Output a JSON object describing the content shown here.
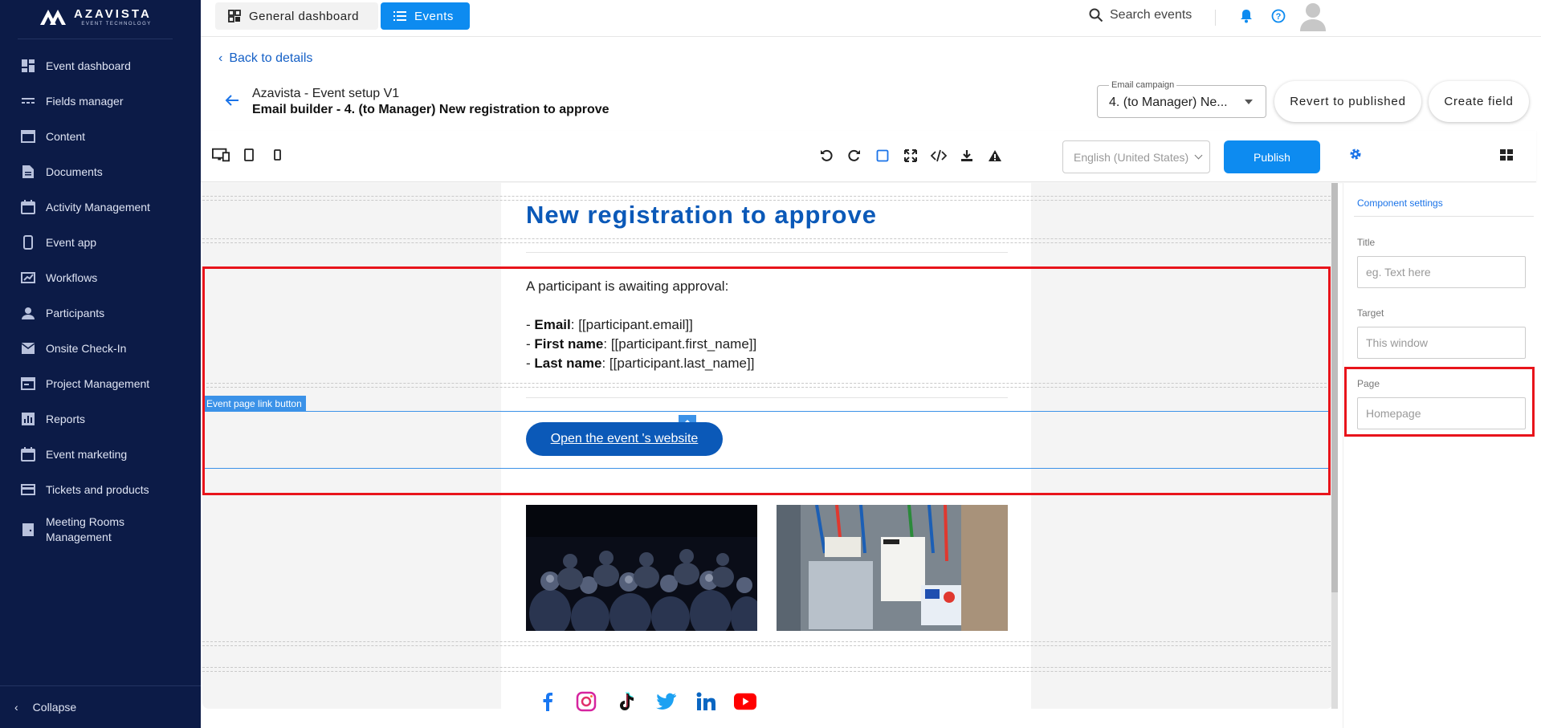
{
  "brand": {
    "name": "AZAVISTA",
    "tagline": "EVENT TECHNOLOGY"
  },
  "sidebar": {
    "items": [
      {
        "label": "Event dashboard",
        "icon": "dashboard-icon"
      },
      {
        "label": "Fields manager",
        "icon": "fields-icon"
      },
      {
        "label": "Content",
        "icon": "content-icon"
      },
      {
        "label": "Documents",
        "icon": "document-icon"
      },
      {
        "label": "Activity Management",
        "icon": "calendar-icon"
      },
      {
        "label": "Event app",
        "icon": "phone-icon"
      },
      {
        "label": "Workflows",
        "icon": "workflow-icon"
      },
      {
        "label": "Participants",
        "icon": "person-icon"
      },
      {
        "label": "Onsite Check-In",
        "icon": "mail-icon"
      },
      {
        "label": "Project Management",
        "icon": "project-icon"
      },
      {
        "label": "Reports",
        "icon": "chart-icon"
      },
      {
        "label": "Event marketing",
        "icon": "calendar-icon"
      },
      {
        "label": "Tickets and products",
        "icon": "card-icon"
      },
      {
        "label": "Meeting Rooms Management",
        "icon": "room-icon"
      }
    ],
    "collapse_label": "Collapse"
  },
  "topbar": {
    "tabs": [
      {
        "label": "General dashboard",
        "icon": "grid-icon"
      },
      {
        "label": "Events",
        "icon": "list-icon"
      }
    ],
    "search_label": "Search events"
  },
  "header": {
    "back_label": "Back to details",
    "title": "Azavista - Event setup V1",
    "subtitle": "Email builder - 4. (to Manager) New registration to approve",
    "campaign_label": "Email campaign",
    "campaign_value": "4. (to Manager) Ne...",
    "revert_label": "Revert to published",
    "create_label": "Create field"
  },
  "toolbar": {
    "language": "English (United States)",
    "publish_label": "Publish"
  },
  "email": {
    "heading": "New registration to approve",
    "intro": "A participant is awaiting approval:",
    "fields": [
      {
        "name": "Email",
        "value": ": [[participant.email]]"
      },
      {
        "name": "First name",
        "value": ": [[participant.first_name]]"
      },
      {
        "name": "Last name",
        "value": ": [[participant.last_name]]"
      }
    ],
    "block_tag": "Event page link button",
    "cta_label": "Open the event 's website"
  },
  "panel": {
    "title": "Component settings",
    "fields": [
      {
        "label": "Title",
        "placeholder": "eg. Text here"
      },
      {
        "label": "Target",
        "placeholder": "This window"
      },
      {
        "label": "Page",
        "placeholder": "Homepage"
      }
    ]
  },
  "colors": {
    "accent": "#0d8bf0",
    "sidebar": "#0c1b47",
    "email_blue": "#0b59b8",
    "highlight": "#e8141b"
  }
}
